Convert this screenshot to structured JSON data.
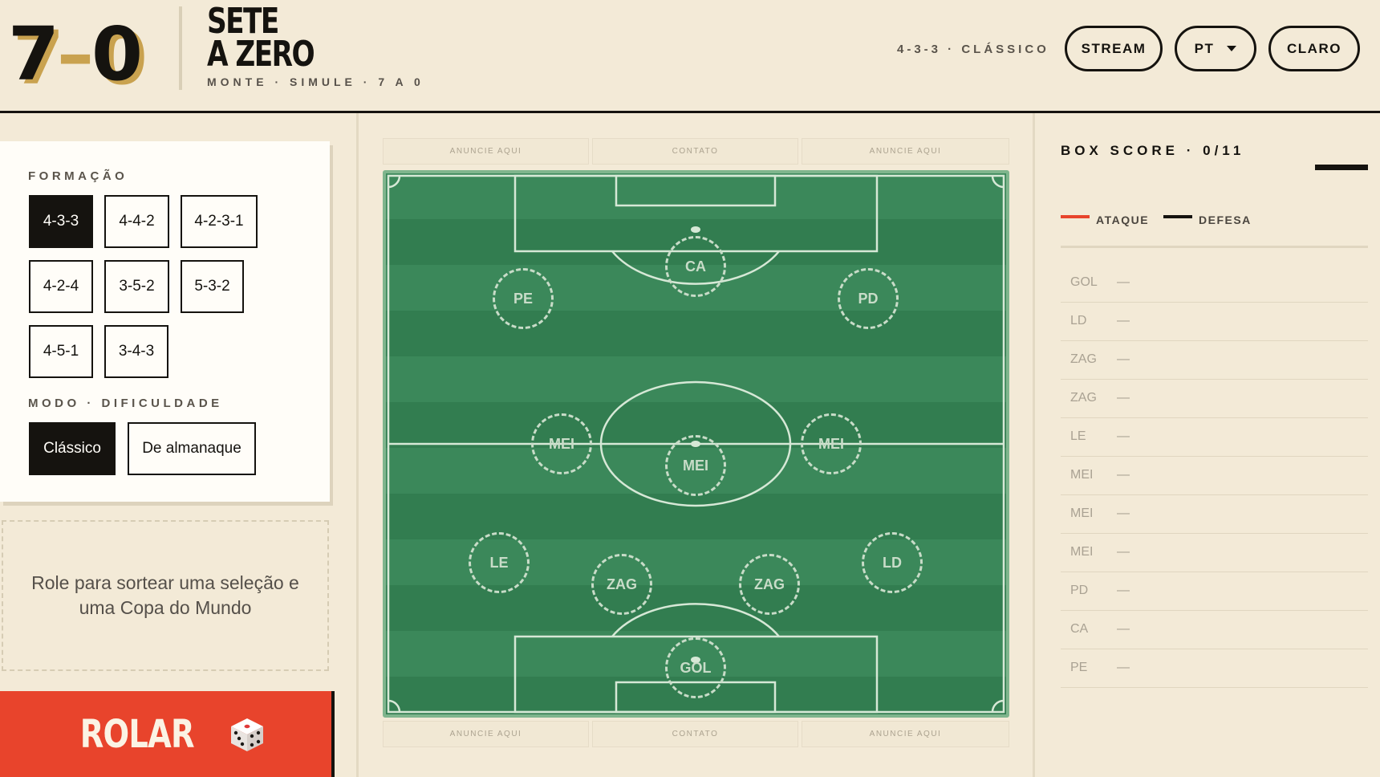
{
  "header": {
    "logo": {
      "left": "7",
      "dash": "–",
      "right": "0"
    },
    "brand_line1": "SETE",
    "brand_line2": "A ZERO",
    "tagline": "MONTE · SIMULE · 7 A 0",
    "formation_label": "4-3-3 · CLÁSSICO",
    "buttons": {
      "stream": "STREAM",
      "language": "PT",
      "theme": "CLARO"
    }
  },
  "sidebar": {
    "formation_title": "FORMAÇÃO",
    "formations": [
      "4-3-3",
      "4-4-2",
      "4-2-3-1",
      "4-2-4",
      "3-5-2",
      "5-3-2",
      "4-5-1",
      "3-4-3"
    ],
    "active_formation": "4-3-3",
    "mode_title": "MODO · DIFICULDADE",
    "modes": [
      "Clássico",
      "De almanaque"
    ],
    "active_mode": "Clássico",
    "hint": "Role para sortear uma seleção e uma Copa do Mundo",
    "roll_label": "ROLAR"
  },
  "pitch": {
    "ads_top": [
      "ANUNCIE AQUI",
      "CONTATO",
      "ANUNCIE AQUI"
    ],
    "ads_bottom": [
      "ANUNCIE AQUI",
      "CONTATO",
      "ANUNCIE AQUI"
    ],
    "positions": [
      "CA",
      "PE",
      "PD",
      "MEI",
      "MEI",
      "MEI",
      "LE",
      "ZAG",
      "ZAG",
      "LD",
      "GOL"
    ]
  },
  "box_score": {
    "title": "BOX SCORE · 0/11",
    "legend": [
      {
        "label": "ATAQUE",
        "color": "#e8442c"
      },
      {
        "label": "DEFESA",
        "color": "#15130f"
      }
    ],
    "rows": [
      {
        "pos": "GOL",
        "value": "—"
      },
      {
        "pos": "LD",
        "value": "—"
      },
      {
        "pos": "ZAG",
        "value": "—"
      },
      {
        "pos": "ZAG",
        "value": "—"
      },
      {
        "pos": "LE",
        "value": "—"
      },
      {
        "pos": "MEI",
        "value": "—"
      },
      {
        "pos": "MEI",
        "value": "—"
      },
      {
        "pos": "MEI",
        "value": "—"
      },
      {
        "pos": "PD",
        "value": "—"
      },
      {
        "pos": "CA",
        "value": "—"
      },
      {
        "pos": "PE",
        "value": "—"
      }
    ]
  },
  "colors": {
    "background": "#f3ead7",
    "ink": "#15130f",
    "accent_gold": "#c9a24f",
    "accent_red": "#e8442c",
    "pitch_green": "#3b885a"
  }
}
